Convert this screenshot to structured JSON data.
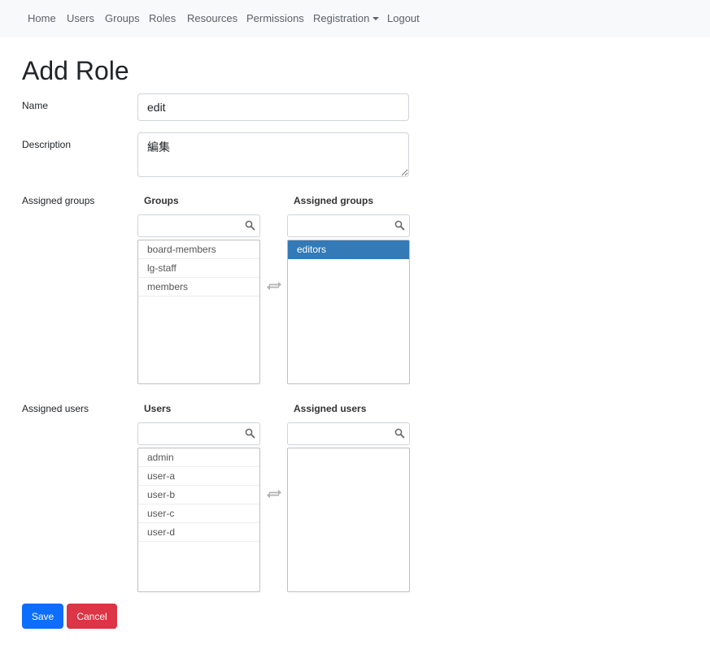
{
  "navbar": {
    "items": [
      {
        "label": "Home"
      },
      {
        "label": "Users"
      },
      {
        "label": "Groups"
      },
      {
        "label": "Roles"
      },
      {
        "label": "Resources"
      },
      {
        "label": "Permissions"
      },
      {
        "label": "Registration",
        "dropdown": true
      },
      {
        "label": "Logout"
      }
    ]
  },
  "page": {
    "title": "Add Role"
  },
  "form": {
    "name_label": "Name",
    "name_value": "edit",
    "description_label": "Description",
    "description_value": "編集",
    "assigned_groups_label": "Assigned groups",
    "assigned_users_label": "Assigned users"
  },
  "groups_selector": {
    "available_header": "Groups",
    "assigned_header": "Assigned groups",
    "available_filter": "",
    "assigned_filter": "",
    "available_items": [
      "board-members",
      "lg-staff",
      "members"
    ],
    "assigned_items": [
      {
        "label": "editors",
        "selected": true
      }
    ]
  },
  "users_selector": {
    "available_header": "Users",
    "assigned_header": "Assigned users",
    "available_filter": "",
    "assigned_filter": "",
    "available_items": [
      "admin",
      "user-a",
      "user-b",
      "user-c",
      "user-d"
    ],
    "assigned_items": []
  },
  "actions": {
    "save_label": "Save",
    "cancel_label": "Cancel"
  },
  "colors": {
    "navbar_bg": "#f8f9fa",
    "selected_item": "#337ab7",
    "save_button": "#0d6efd",
    "cancel_button": "#dc3545"
  },
  "icons": {
    "filter": "search-icon",
    "transfer": "swap-arrows-icon",
    "dropdown": "caret-down-icon"
  }
}
